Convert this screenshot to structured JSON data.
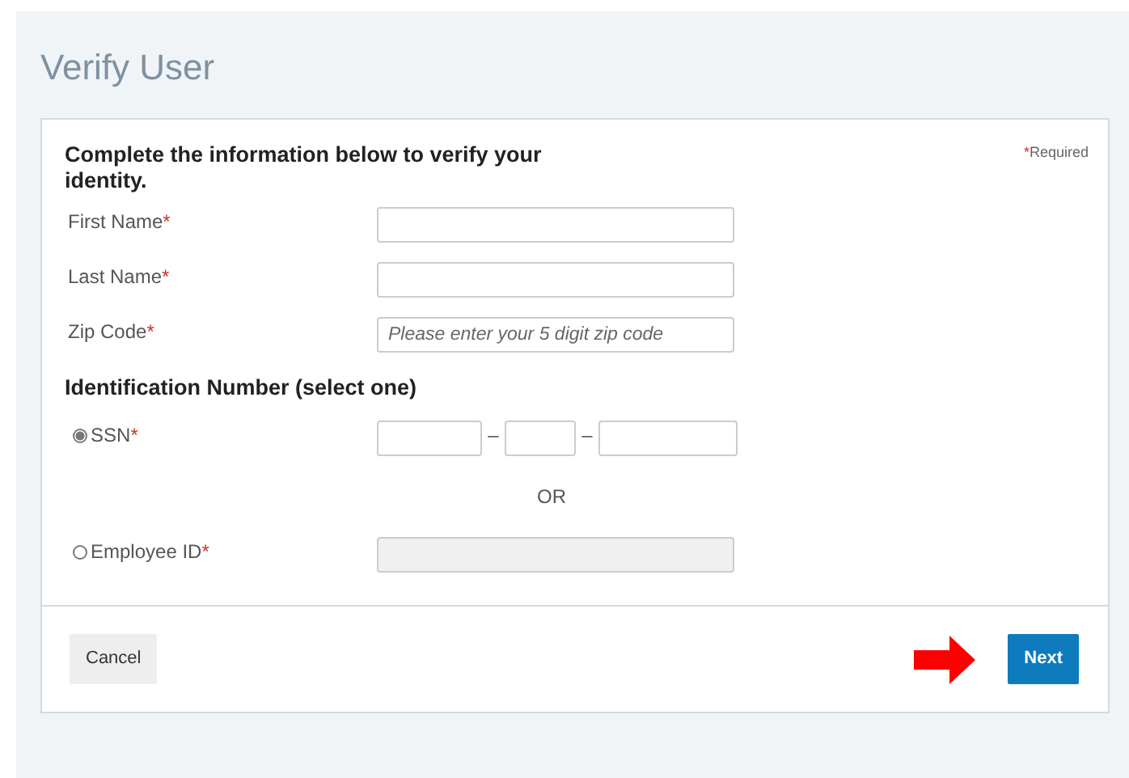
{
  "page_title": "Verify User",
  "card": {
    "heading": "Complete the information below to verify your identity.",
    "required_note": {
      "marker": "*",
      "text": "Required"
    }
  },
  "fields": [
    {
      "label": "First Name",
      "marker": "*",
      "kind": "text"
    },
    {
      "label": "Last Name",
      "marker": "*",
      "kind": "text"
    },
    {
      "label": "Zip Code",
      "marker": "*",
      "kind": "text",
      "placeholder": "Please enter your 5 digit zip code"
    }
  ],
  "id_section": {
    "heading": "Identification Number (select one)",
    "options": [
      {
        "label": "SSN",
        "marker": "*",
        "selected": true,
        "kind": "ssn",
        "separators": [
          "–",
          "–"
        ]
      },
      {
        "label": "Employee ID",
        "marker": "*",
        "selected": false,
        "kind": "single",
        "disabled": true
      }
    ],
    "divider_text": "OR"
  },
  "buttons": [
    {
      "label": "Cancel",
      "kind": "secondary"
    },
    {
      "label": "Next",
      "kind": "primary"
    }
  ]
}
